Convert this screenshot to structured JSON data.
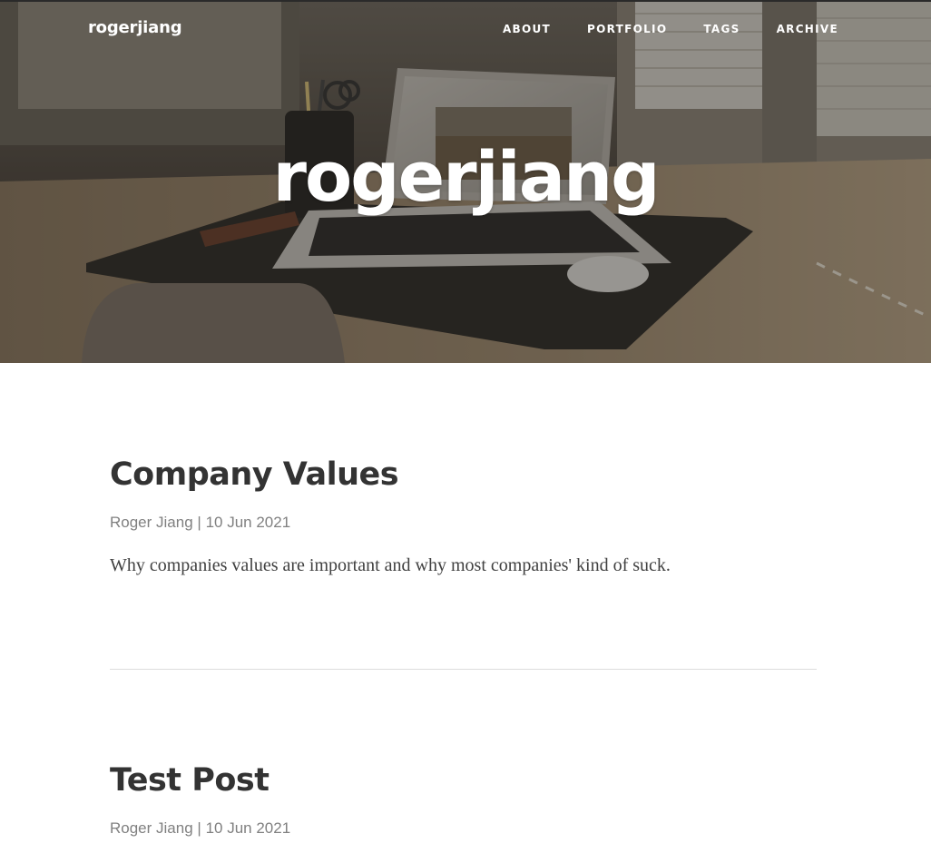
{
  "site": {
    "brand": "rogerjiang",
    "hero_title": "rogerjiang"
  },
  "nav": {
    "items": [
      {
        "label": "ABOUT"
      },
      {
        "label": "PORTFOLIO"
      },
      {
        "label": "TAGS"
      },
      {
        "label": "ARCHIVE"
      }
    ]
  },
  "posts": [
    {
      "title": "Company Values",
      "author": "Roger Jiang",
      "separator": "|",
      "date": "10 Jun 2021",
      "subtitle": "Why companies values are important and why most companies' kind of suck."
    },
    {
      "title": "Test Post",
      "author": "Roger Jiang",
      "separator": "|",
      "date": "10 Jun 2021"
    }
  ],
  "colors": {
    "text_dark": "#333333",
    "meta_gray": "#808080",
    "divider": "#dddddd",
    "hero_text": "#ffffff"
  }
}
